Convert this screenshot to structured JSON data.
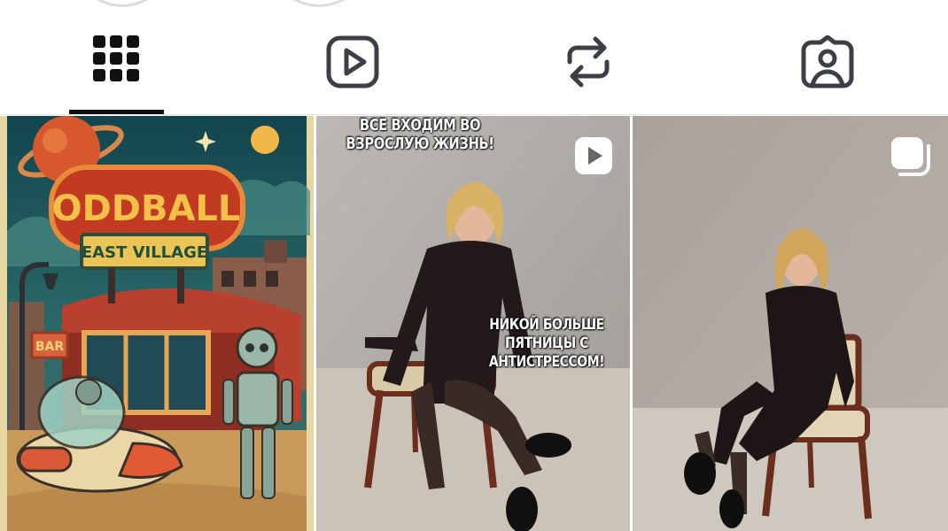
{
  "tabs": [
    {
      "name": "posts-grid",
      "icon": "grid-icon",
      "selected": true
    },
    {
      "name": "reels",
      "icon": "reels-play-icon",
      "selected": false
    },
    {
      "name": "reposts",
      "icon": "repost-icon",
      "selected": false
    },
    {
      "name": "tagged",
      "icon": "tagged-person-icon",
      "selected": false
    }
  ],
  "colors": {
    "icon": "#3c3f46",
    "indicator": "#111111",
    "divider": "#e4e6ea"
  },
  "posts": [
    {
      "type": "image",
      "illustration_text": [
        "ODDBALL",
        "EAST VILLAGE",
        "BAR"
      ]
    },
    {
      "type": "reel",
      "badge_icon": "reel-play-badge-icon",
      "top_caption": "ВСЕ ВХОДИМ ВО ВЗРОСЛУЮ ЖИЗНЬ!",
      "middle_caption_line1": "НИКОЙ БОЛЬШЕ ПЯТНИЦЫ С",
      "middle_caption_line2": "АНТИСТРЕССОМ!"
    },
    {
      "type": "carousel",
      "badge_icon": "carousel-stack-badge-icon"
    }
  ]
}
